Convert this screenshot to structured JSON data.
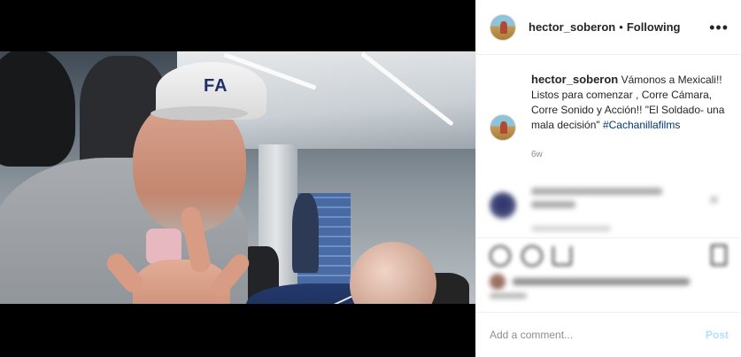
{
  "post": {
    "username": "hector_soberon",
    "separator": "•",
    "follow_status": "Following",
    "more_options": "•••",
    "caption_text": "Vámonos a Mexicali!! Listos para comenzar , Corre Cámara, Corre Sonido y Acción!! \"El Soldado- una mala decisión\" ",
    "hashtag": "#Cachanillafilms",
    "time_ago": "6w",
    "cap_logo": "FA"
  },
  "comment_box": {
    "placeholder": "Add a comment...",
    "post_label": "Post"
  },
  "colors": {
    "link": "#00376b",
    "post_disabled": "#b2dffc",
    "secondary_text": "#8e8e8e"
  },
  "icons": {
    "more": "more-options-icon",
    "like": "heart-icon",
    "comment": "comment-icon",
    "share": "share-icon",
    "save": "bookmark-icon"
  }
}
